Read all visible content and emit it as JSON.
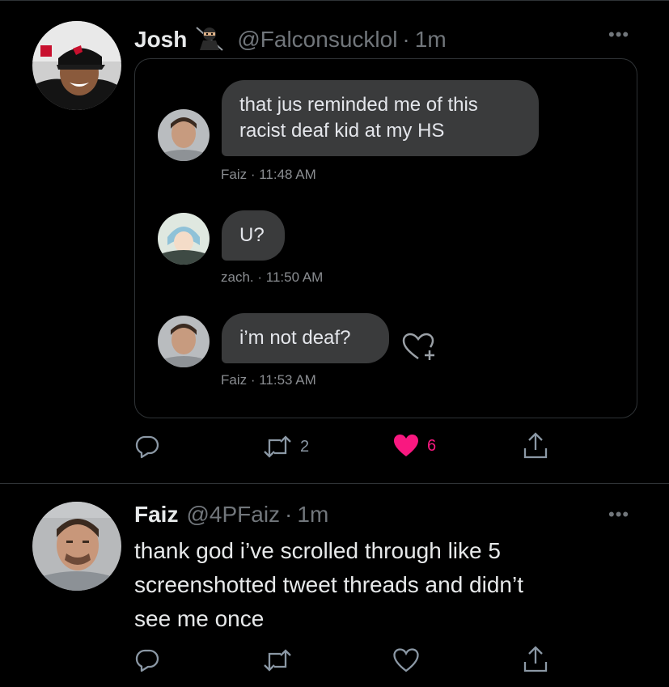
{
  "tweet1": {
    "name": "Josh",
    "name_emoji": "ninja",
    "handle": "@Falconsucklol",
    "dot": "·",
    "time": "1m",
    "more": "•••",
    "dm": [
      {
        "text_lines": [
          "that jus reminded me of this",
          "racist deaf kid at my HS"
        ],
        "sender": "Faiz",
        "time": "11:48 AM"
      },
      {
        "text_lines": [
          "U?"
        ],
        "sender": "zach.",
        "time": "11:50 AM"
      },
      {
        "text_lines": [
          "i’m not deaf?"
        ],
        "sender": "Faiz",
        "time": "11:53 AM"
      }
    ],
    "actions": {
      "reply_count": "",
      "retweet_count": "2",
      "like_count": "6",
      "liked": true
    }
  },
  "tweet2": {
    "name": "Faiz",
    "handle": "@4PFaiz",
    "dot": "·",
    "time": "1m",
    "more": "•••",
    "text_lines": [
      "thank god i’ve scrolled through like 5",
      "screenshotted tweet threads and didn’t",
      "see me once"
    ],
    "actions": {
      "reply_count": "",
      "retweet_count": "",
      "like_count": "",
      "liked": false
    }
  },
  "colors": {
    "background": "#000000",
    "bubble": "#3a3b3c",
    "like": "#f91880",
    "muted": "#71767b"
  },
  "meta_separator": " · "
}
